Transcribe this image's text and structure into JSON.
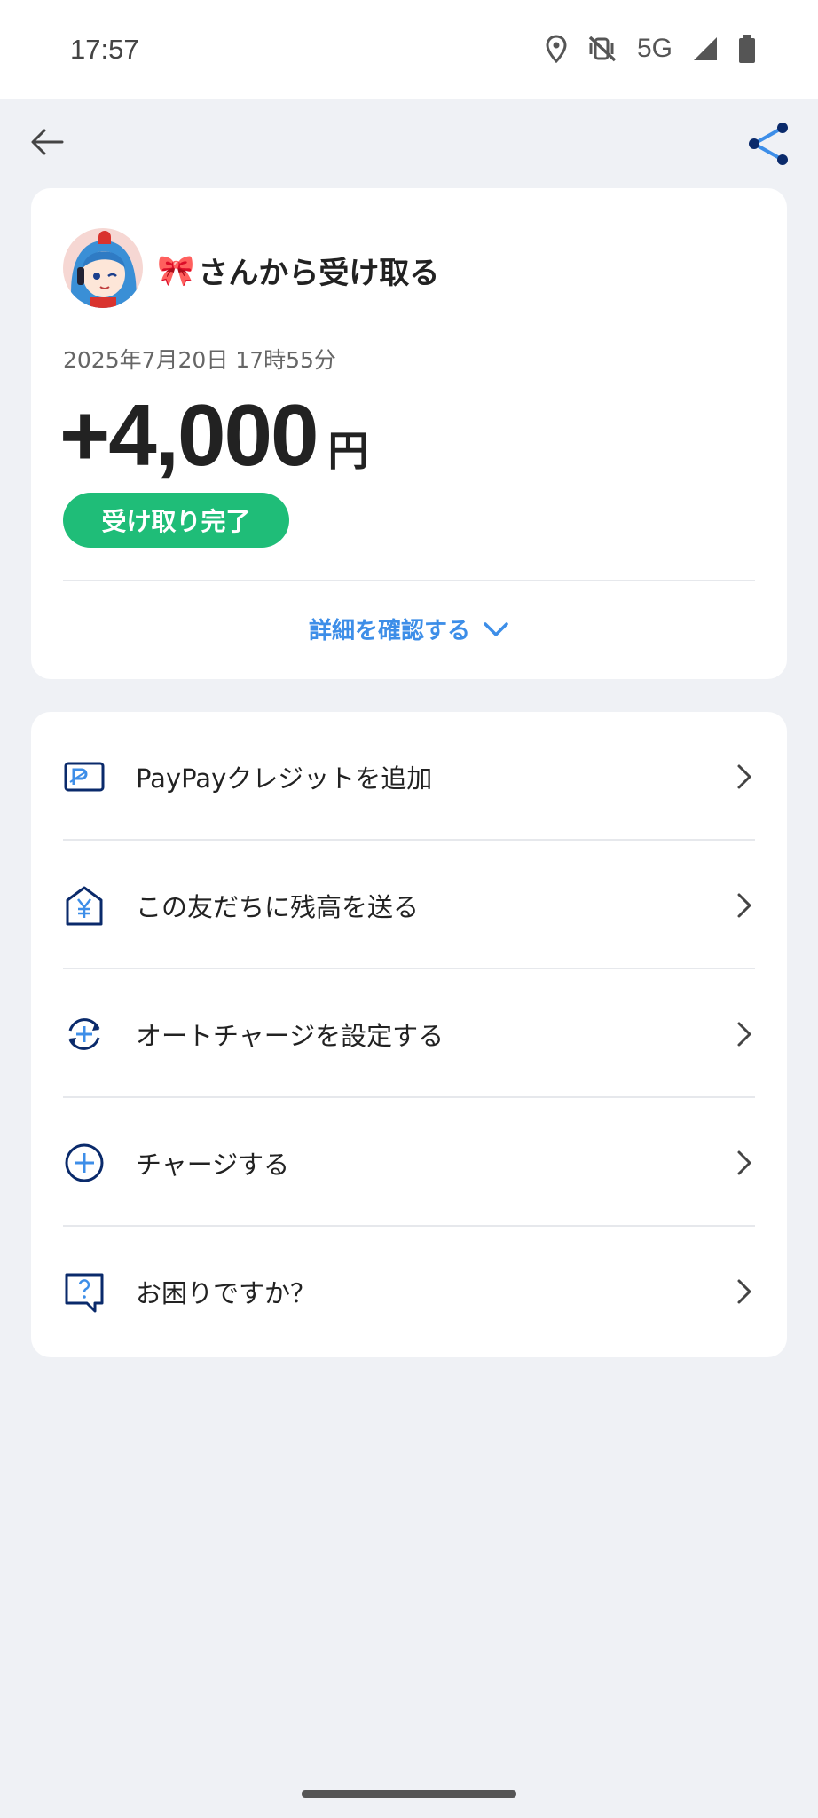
{
  "status_bar": {
    "time": "17:57",
    "network": "5G"
  },
  "header": {
    "back_icon": "arrow-left-icon",
    "share_icon": "share-icon"
  },
  "transaction": {
    "sender_emoji": "🎀",
    "sender_text": "さんから受け取る",
    "date": "2025年7月20日 17時55分",
    "amount": "+4,000",
    "currency": "円",
    "status": "受け取り完了",
    "details_label": "詳細を確認する"
  },
  "menu": {
    "items": [
      {
        "label": "PayPayクレジットを追加",
        "icon": "credit-card-icon"
      },
      {
        "label": "この友だちに残高を送る",
        "icon": "yen-house-icon"
      },
      {
        "label": "オートチャージを設定する",
        "icon": "auto-charge-icon"
      },
      {
        "label": "チャージする",
        "icon": "plus-circle-icon"
      },
      {
        "label": "お困りですか？",
        "icon": "help-chat-icon"
      }
    ]
  },
  "colors": {
    "accent_blue": "#3d8ee8",
    "navy": "#0a2a6b",
    "success_green": "#1fbd78",
    "background": "#eff1f5"
  }
}
